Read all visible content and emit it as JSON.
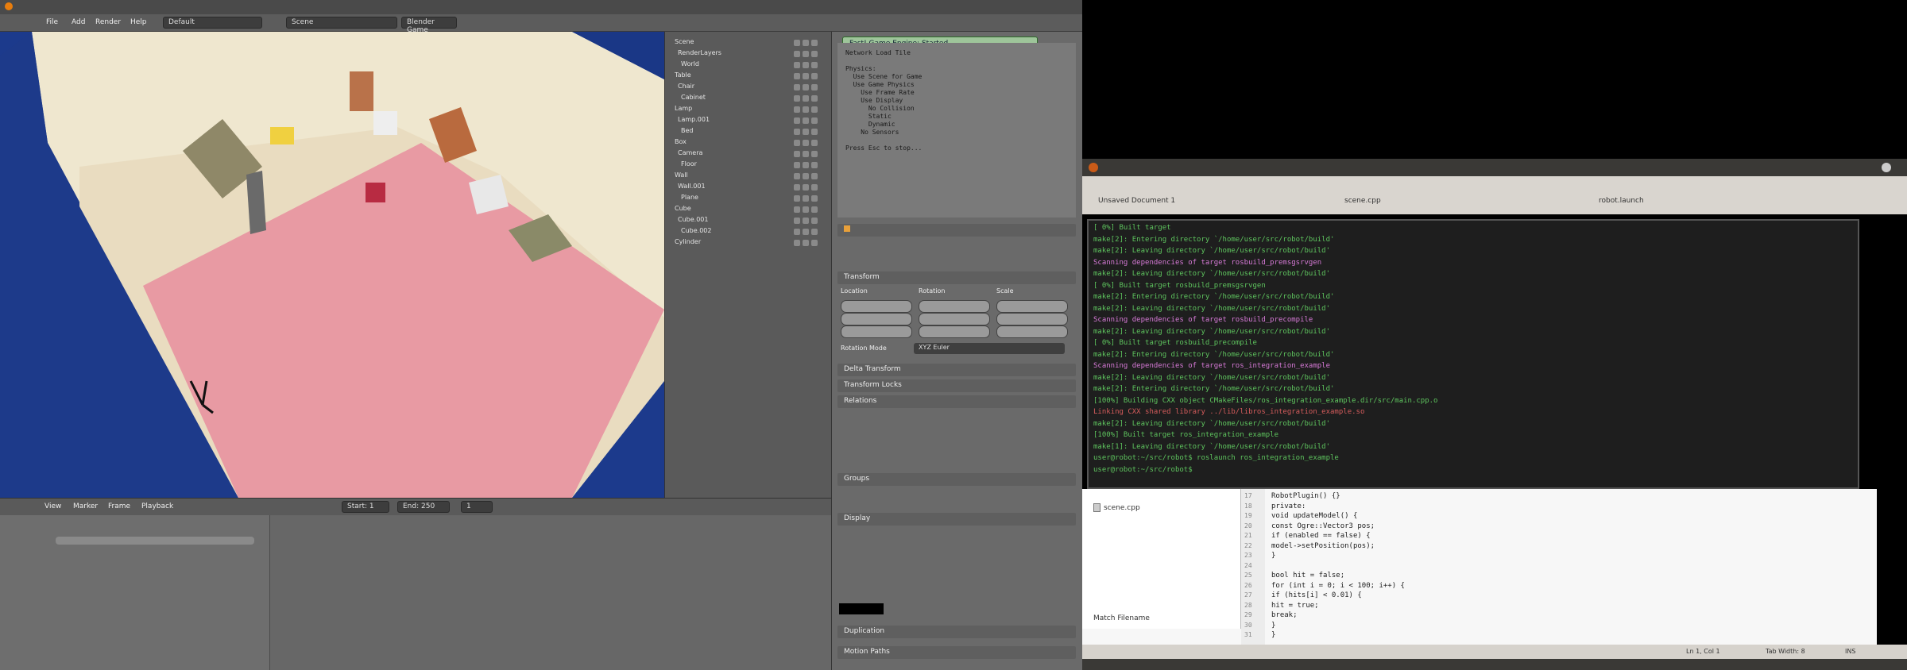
{
  "blender": {
    "menu": [
      "File",
      "Add",
      "Render",
      "Help"
    ],
    "layout_field": "Default",
    "scene_field": "Scene",
    "engine_field": "Blender Game",
    "outliner_rows": [
      "Scene",
      "RenderLayers",
      "World",
      "Table",
      "Chair",
      "Cabinet",
      "Lamp",
      "Lamp.001",
      "Bed",
      "Box",
      "Camera",
      "Floor",
      "Wall",
      "Wall.001",
      "Plane",
      "Cube",
      "Cube.001",
      "Cube.002",
      "Cylinder"
    ],
    "info_button": "Fast! Game Engine: Started",
    "info_text": "Network Load Tile\n\nPhysics:\n  Use Scene for Game\n  Use Game Physics\n    Use Frame Rate\n    Use Display\n      No Collision\n      Static\n      Dynamic\n    No Sensors\n\nPress Esc to stop...",
    "props_panels": [
      "Transform",
      "Location",
      "Rotation",
      "Scale",
      "Delta Transform",
      "Transform Locks",
      "Relations",
      "Groups",
      "Display",
      "Duplication",
      "Motion Paths"
    ],
    "rotation_mode_label": "Rotation Mode",
    "rotation_mode_value": "XYZ Euler",
    "timeline_labels": [
      "View",
      "Marker",
      "Frame",
      "Playback"
    ],
    "tl_start": "Start: 1",
    "tl_end": "End: 250",
    "tl_frame": "1"
  },
  "terminal": {
    "lines": [
      {
        "t": "[ 0%] Built target",
        "c": "#5ec45e"
      },
      {
        "t": "make[2]: Entering directory `/home/user/src/robot/build'",
        "c": "#5ec45e"
      },
      {
        "t": "make[2]: Leaving directory `/home/user/src/robot/build'",
        "c": "#5ec45e"
      },
      {
        "t": "Scanning dependencies of target rosbuild_premsgsrvgen",
        "c": "#d77ad7"
      },
      {
        "t": "make[2]: Leaving directory `/home/user/src/robot/build'",
        "c": "#5ec45e"
      },
      {
        "t": "[ 0%] Built target rosbuild_premsgsrvgen",
        "c": "#5ec45e"
      },
      {
        "t": "make[2]: Entering directory `/home/user/src/robot/build'",
        "c": "#5ec45e"
      },
      {
        "t": "make[2]: Leaving directory `/home/user/src/robot/build'",
        "c": "#5ec45e"
      },
      {
        "t": "Scanning dependencies of target rosbuild_precompile",
        "c": "#d77ad7"
      },
      {
        "t": "make[2]: Leaving directory `/home/user/src/robot/build'",
        "c": "#5ec45e"
      },
      {
        "t": "[ 0%] Built target rosbuild_precompile",
        "c": "#5ec45e"
      },
      {
        "t": "make[2]: Entering directory `/home/user/src/robot/build'",
        "c": "#5ec45e"
      },
      {
        "t": "Scanning dependencies of target ros_integration_example",
        "c": "#d77ad7"
      },
      {
        "t": "make[2]: Leaving directory `/home/user/src/robot/build'",
        "c": "#5ec45e"
      },
      {
        "t": "make[2]: Entering directory `/home/user/src/robot/build'",
        "c": "#5ec45e"
      },
      {
        "t": "[100%] Building CXX object CMakeFiles/ros_integration_example.dir/src/main.cpp.o",
        "c": "#5ec45e"
      },
      {
        "t": "Linking CXX shared library ../lib/libros_integration_example.so",
        "c": "#d65c5c"
      },
      {
        "t": "make[2]: Leaving directory `/home/user/src/robot/build'",
        "c": "#5ec45e"
      },
      {
        "t": "[100%] Built target ros_integration_example",
        "c": "#5ec45e"
      },
      {
        "t": "make[1]: Leaving directory `/home/user/src/robot/build'",
        "c": "#5ec45e"
      },
      {
        "t": "user@robot:~/src/robot$ roslaunch ros_integration_example",
        "c": "#5ec45e"
      },
      {
        "t": "user@robot:~/src/robot$",
        "c": "#5ec45e"
      }
    ]
  },
  "editor": {
    "file": "scene.cpp",
    "tabs": [
      "Unsaved Document 1",
      "scene.cpp",
      "robot.launch"
    ],
    "match_label": "Match Filename",
    "line_numbers": [
      "17",
      "18",
      "19",
      "20",
      "21",
      "22",
      "23",
      "24",
      "25",
      "26",
      "27",
      "28",
      "29",
      "30",
      "31"
    ],
    "code": [
      "    RobotPlugin() {}",
      "  private:",
      "    void updateModel() {",
      "      const Ogre::Vector3 pos;",
      "      if (enabled == false) {",
      "        model->setPosition(pos);",
      "      }",
      "",
      "      bool hit = false;",
      "      for (int i = 0; i < 100; i++) {",
      "        if (hits[i] < 0.01) {",
      "          hit = true;",
      "          break;",
      "        }",
      "      }"
    ],
    "status_pos": "Ln 1, Col 1",
    "status_mode": "INS",
    "status_tab": "Tab Width: 8"
  }
}
